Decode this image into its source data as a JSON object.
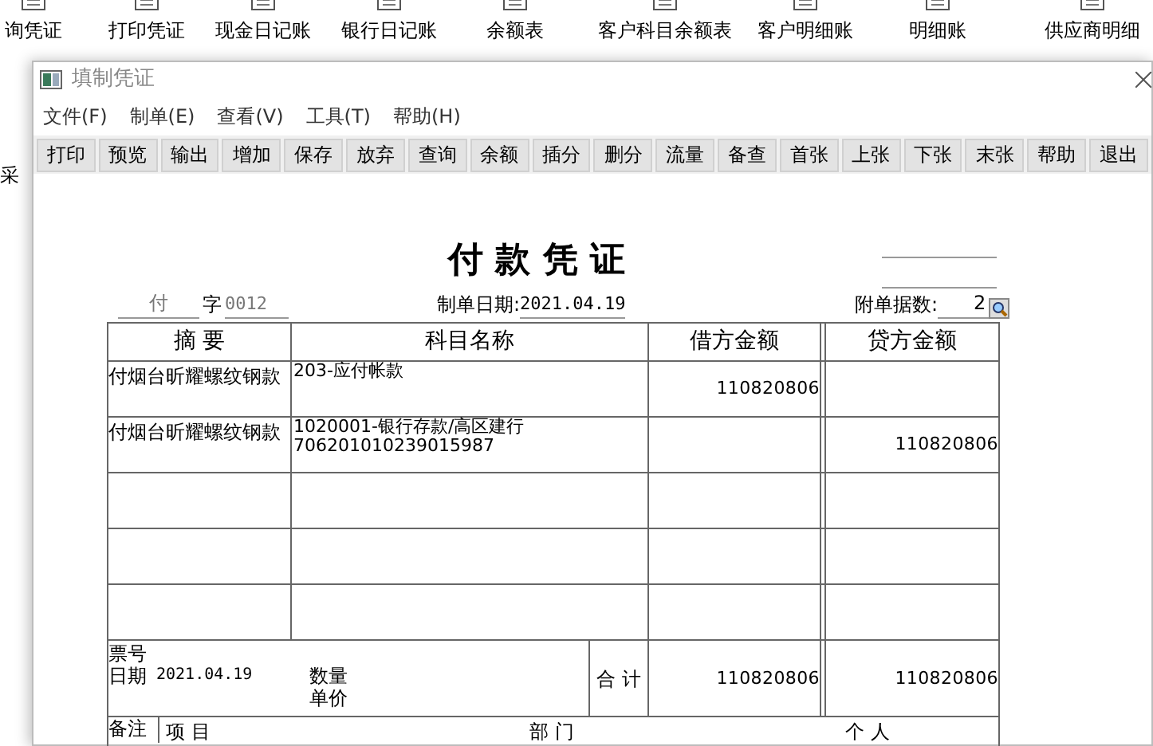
{
  "desktop_icons": [
    {
      "label": "询凭证"
    },
    {
      "label": "打印凭证"
    },
    {
      "label": "现金日记账"
    },
    {
      "label": "银行日记账"
    },
    {
      "label": "余额表"
    },
    {
      "label": "客户科目余额表"
    },
    {
      "label": "客户明细账"
    },
    {
      "label": "明细账"
    },
    {
      "label": "供应商明细"
    }
  ],
  "background_text": "采",
  "window": {
    "title": "填制凭证"
  },
  "menu": [
    "文件(F)",
    "制单(E)",
    "查看(V)",
    "工具(T)",
    "帮助(H)"
  ],
  "toolbar": [
    "打印",
    "预览",
    "输出",
    "增加",
    "保存",
    "放弃",
    "查询",
    "余额",
    "插分",
    "删分",
    "流量",
    "备查",
    "首张",
    "上张",
    "下张",
    "末张",
    "帮助",
    "退出"
  ],
  "voucher": {
    "title": "付 款 凭 证",
    "type": "付",
    "type_suffix": "字",
    "number": "0012",
    "date_label": "制单日期:",
    "date": "2021.04.19",
    "attachments_label": "附单据数:",
    "attachments": "2",
    "columns": [
      "摘 要",
      "科目名称",
      "借方金额",
      "贷方金额"
    ],
    "rows": [
      {
        "summary": "付烟台昕耀螺纹钢款",
        "account": [
          "203-应付帐款"
        ],
        "debit": "110820806",
        "credit": ""
      },
      {
        "summary": "付烟台昕耀螺纹钢款",
        "account": [
          "1020001-银行存款/高区建行",
          "706201010239015987"
        ],
        "debit": "",
        "credit": "110820806"
      },
      {
        "summary": "",
        "account": [],
        "debit": "",
        "credit": ""
      },
      {
        "summary": "",
        "account": [],
        "debit": "",
        "credit": ""
      },
      {
        "summary": "",
        "account": [],
        "debit": "",
        "credit": ""
      }
    ],
    "totals": {
      "ticket_label": "票号",
      "date_label": "日期",
      "date": "2021.04.19",
      "quantity_label": "数量",
      "price_label": "单价",
      "total_label": "合 计",
      "debit": "110820806",
      "credit": "110820806"
    },
    "remarks": {
      "label": "备注",
      "fields": [
        "项 目",
        "部 门",
        "个 人"
      ]
    }
  }
}
